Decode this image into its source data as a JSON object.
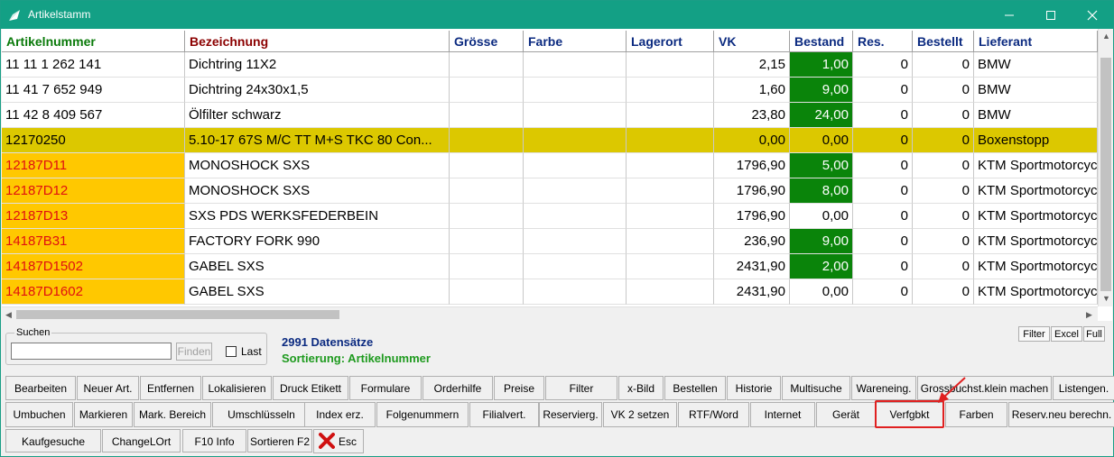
{
  "window": {
    "title": "Artikelstamm"
  },
  "columns": [
    "Artikelnummer",
    "Bezeichnung",
    "Grösse",
    "Farbe",
    "Lagerort",
    "VK",
    "Bestand",
    "Res.",
    "Bestellt",
    "Lieferant"
  ],
  "rows": [
    {
      "artnr": "11 11 1 262 141",
      "bez": "Dichtring 11X2",
      "groesse": "",
      "farbe": "",
      "lagerort": "",
      "vk": "2,15",
      "bestand": "1,00",
      "res": "0",
      "bestellt": "0",
      "lieferant": "BMW",
      "row_bg": "#ffffff",
      "art_bg": "#ffffff",
      "art_color": "#000000",
      "bestand_bg": "#0a840a",
      "bestand_color": "#ffffff"
    },
    {
      "artnr": "11 41 7 652 949",
      "bez": "Dichtring 24x30x1,5",
      "groesse": "",
      "farbe": "",
      "lagerort": "",
      "vk": "1,60",
      "bestand": "9,00",
      "res": "0",
      "bestellt": "0",
      "lieferant": "BMW",
      "row_bg": "#ffffff",
      "art_bg": "#ffffff",
      "art_color": "#000000",
      "bestand_bg": "#0a840a",
      "bestand_color": "#ffffff"
    },
    {
      "artnr": "11 42 8 409 567",
      "bez": "Ölfilter schwarz",
      "groesse": "",
      "farbe": "",
      "lagerort": "",
      "vk": "23,80",
      "bestand": "24,00",
      "res": "0",
      "bestellt": "0",
      "lieferant": "BMW",
      "row_bg": "#ffffff",
      "art_bg": "#ffffff",
      "art_color": "#000000",
      "bestand_bg": "#0a840a",
      "bestand_color": "#ffffff"
    },
    {
      "artnr": "12170250",
      "bez": "5.10-17 67S M/C TT M+S TKC 80 Con...",
      "groesse": "",
      "farbe": "",
      "lagerort": "",
      "vk": "0,00",
      "bestand": "0,00",
      "res": "0",
      "bestellt": "0",
      "lieferant": "Boxenstopp",
      "row_bg": "#dcc800",
      "art_bg": "#dcc800",
      "art_color": "#000000",
      "bestand_bg": "#dcc800",
      "bestand_color": "#000000"
    },
    {
      "artnr": "12187D11",
      "bez": "MONOSHOCK SXS",
      "groesse": "",
      "farbe": "",
      "lagerort": "",
      "vk": "1796,90",
      "bestand": "5,00",
      "res": "0",
      "bestellt": "0",
      "lieferant": "KTM Sportmotorcycle",
      "row_bg": "#ffffff",
      "art_bg": "#ffc800",
      "art_color": "#e01010",
      "bestand_bg": "#0a840a",
      "bestand_color": "#ffffff"
    },
    {
      "artnr": "12187D12",
      "bez": "MONOSHOCK SXS",
      "groesse": "",
      "farbe": "",
      "lagerort": "",
      "vk": "1796,90",
      "bestand": "8,00",
      "res": "0",
      "bestellt": "0",
      "lieferant": "KTM Sportmotorcycle",
      "row_bg": "#ffffff",
      "art_bg": "#ffc800",
      "art_color": "#e01010",
      "bestand_bg": "#0a840a",
      "bestand_color": "#ffffff"
    },
    {
      "artnr": "12187D13",
      "bez": "SXS PDS WERKSFEDERBEIN",
      "groesse": "",
      "farbe": "",
      "lagerort": "",
      "vk": "1796,90",
      "bestand": "0,00",
      "res": "0",
      "bestellt": "0",
      "lieferant": "KTM Sportmotorcycle",
      "row_bg": "#ffffff",
      "art_bg": "#ffc800",
      "art_color": "#e01010",
      "bestand_bg": "#ffffff",
      "bestand_color": "#000000"
    },
    {
      "artnr": "14187B31",
      "bez": "FACTORY FORK 990",
      "groesse": "",
      "farbe": "",
      "lagerort": "",
      "vk": "236,90",
      "bestand": "9,00",
      "res": "0",
      "bestellt": "0",
      "lieferant": "KTM Sportmotorcycle",
      "row_bg": "#ffffff",
      "art_bg": "#ffc800",
      "art_color": "#e01010",
      "bestand_bg": "#0a840a",
      "bestand_color": "#ffffff"
    },
    {
      "artnr": "14187D1502",
      "bez": "GABEL SXS",
      "groesse": "",
      "farbe": "",
      "lagerort": "",
      "vk": "2431,90",
      "bestand": "2,00",
      "res": "0",
      "bestellt": "0",
      "lieferant": "KTM Sportmotorcycle",
      "row_bg": "#ffffff",
      "art_bg": "#ffc800",
      "art_color": "#e01010",
      "bestand_bg": "#0a840a",
      "bestand_color": "#ffffff"
    },
    {
      "artnr": "14187D1602",
      "bez": "GABEL SXS",
      "groesse": "",
      "farbe": "",
      "lagerort": "",
      "vk": "2431,90",
      "bestand": "0,00",
      "res": "0",
      "bestellt": "0",
      "lieferant": "KTM Sportmotorcycle",
      "row_bg": "#ffffff",
      "art_bg": "#ffc800",
      "art_color": "#e01010",
      "bestand_bg": "#ffffff",
      "bestand_color": "#000000"
    }
  ],
  "search": {
    "label": "Suchen",
    "value": "",
    "find_label": "Finden",
    "last_label": "Last"
  },
  "status": {
    "count": "2991 Datensätze",
    "sort": "Sortierung: Artikelnummer"
  },
  "small_buttons": [
    "Filter",
    "Excel",
    "Full"
  ],
  "toolbar_row1": [
    "Bearbeiten",
    "Neuer Art.",
    "Entfernen",
    "Lokalisieren",
    "Druck Etikett",
    "Formulare",
    "Orderhilfe",
    "Preise",
    "Filter",
    "x-Bild",
    "Bestellen",
    "Historie",
    "Multisuche",
    "Wareneing.",
    "Grossbuchst.klein machen",
    "Listengen."
  ],
  "toolbar_row2": [
    "Umbuchen",
    "Markieren",
    "Mark. Bereich",
    "Umschlüsseln",
    "Index erz.",
    "Folgenummern",
    "Filialvert.",
    "Reservierg.",
    "VK 2 setzen",
    "RTF/Word",
    "Internet",
    "Gerät",
    "Verfgbkt",
    "Farben",
    "Reserv.neu berechn."
  ],
  "toolbar_row3": [
    "Kaufgesuche",
    "ChangeLOrt",
    "F10 Info",
    "Sortieren F2",
    "Esc"
  ],
  "colors": {
    "titlebar": "#13a085",
    "header_green": "#0a7a0a",
    "header_maroon": "#8b0000",
    "header_navy": "#0b2a80",
    "highlight": "#e02020"
  }
}
